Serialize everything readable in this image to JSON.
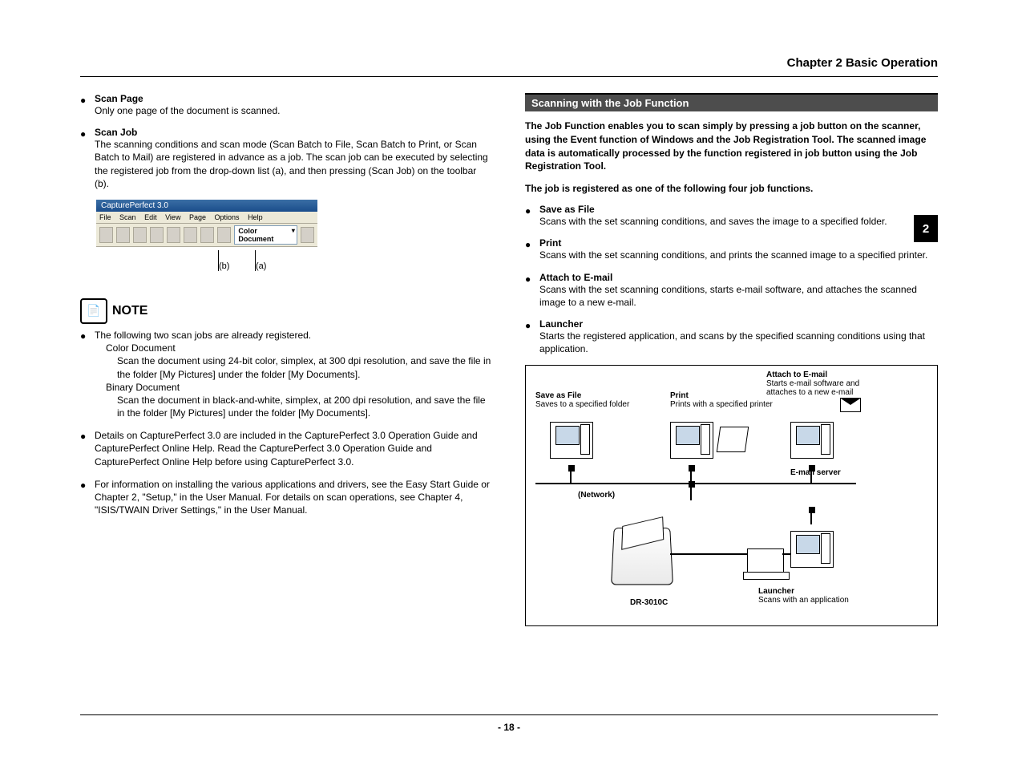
{
  "header": {
    "chapter_title": "Chapter 2 Basic Operation",
    "side_tab": "2",
    "page_number": "- 18 -"
  },
  "left_column": {
    "scan_page": {
      "title": "Scan Page",
      "text": "Only one page of the document is scanned."
    },
    "scan_job": {
      "title": "Scan Job",
      "text": "The scanning conditions and scan mode (Scan Batch to File, Scan Batch to Print, or Scan Batch to Mail) are registered in advance as a job. The scan job can be executed by selecting the registered job from the drop-down list (a), and then pressing (Scan Job) on the toolbar (b)."
    },
    "toolbar": {
      "window_title": "CapturePerfect 3.0",
      "menu": [
        "File",
        "Scan",
        "Edit",
        "View",
        "Page",
        "Options",
        "Help"
      ],
      "dropdown_value": "Color Document",
      "label_b": "(b)",
      "label_a": "(a)"
    },
    "note": {
      "word": "NOTE",
      "items": [
        {
          "text": "The following two scan jobs are already registered.",
          "sub": [
            {
              "title": "Color Document",
              "desc": "Scan the document using 24-bit color, simplex, at 300 dpi resolution, and save the file in the folder [My Pictures] under the folder [My Documents]."
            },
            {
              "title": "Binary Document",
              "desc": "Scan the document in black-and-white, simplex, at 200 dpi resolution, and save the file in the folder [My Pictures] under the folder [My Documents]."
            }
          ]
        },
        {
          "text": "Details on CapturePerfect 3.0 are included in the CapturePerfect 3.0 Operation Guide and CapturePerfect Online Help. Read the CapturePerfect 3.0 Operation Guide and CapturePerfect Online Help before using CapturePerfect 3.0."
        },
        {
          "text": "For information on installing the various applications and drivers, see the Easy Start Guide or Chapter 2, \"Setup,\" in the User Manual. For details on scan operations, see Chapter 4, \"ISIS/TWAIN Driver Settings,\" in the User Manual."
        }
      ]
    }
  },
  "right_column": {
    "section_heading": "Scanning with the Job Function",
    "intro": "The Job Function enables you to scan simply by pressing a job button on the scanner, using the Event function of Windows and the Job Registration Tool. The scanned image data is automatically processed by the function registered in job button using the Job Registration Tool.",
    "job_registered": "The job is registered as one of the following four job functions.",
    "functions": [
      {
        "title": "Save as File",
        "text": "Scans with the set scanning conditions, and saves the image to a specified folder."
      },
      {
        "title": "Print",
        "text": "Scans with the set scanning conditions, and prints the scanned image to a specified printer."
      },
      {
        "title": "Attach to E-mail",
        "text": "Scans with the set scanning conditions, starts e-mail software, and attaches the scanned image to a new e-mail."
      },
      {
        "title": "Launcher",
        "text": "Starts the registered application, and scans by the specified scanning conditions using that application."
      }
    ],
    "diagram": {
      "save_as_file": {
        "title": "Save as File",
        "desc": "Saves to a specified folder"
      },
      "print": {
        "title": "Print",
        "desc": "Prints with a specified printer"
      },
      "attach": {
        "title": "Attach to E-mail",
        "desc": "Starts e-mail software and attaches to a new e-mail"
      },
      "launcher": {
        "title": "Launcher",
        "desc": "Scans with an application"
      },
      "email_server": "E-mail server",
      "network": "(Network)",
      "scanner_model": "DR-3010C"
    }
  }
}
